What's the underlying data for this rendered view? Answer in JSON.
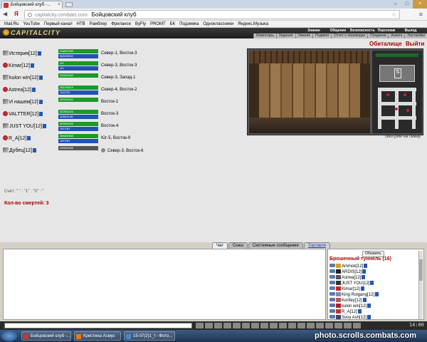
{
  "browser": {
    "tab_title": "Бойцовский клуб -...",
    "url_host": "capitalcity.combats.com",
    "url_title": "Бойцовский клуб",
    "bookmarks": [
      "Mail.Ru",
      "YouTube",
      "Первый канал",
      "НТВ",
      "Рамблер",
      "Фрилансе",
      "ByFly",
      "PROMT",
      "БК",
      "Подземка",
      "Одноклассники",
      "Яндекс.Музыка"
    ]
  },
  "game": {
    "logo": "CAPITALCITY",
    "topmenu": [
      "Знание",
      "Общение",
      "Безопасность",
      "Персонаж",
      "Выход"
    ],
    "submenu": [
      "Инвентарь",
      "Задания",
      "Умения",
      "Подвиги",
      "Отчет о переводах",
      "Поединки",
      "Анкета",
      "Настройки"
    ]
  },
  "players": [
    {
      "name": "Истерия",
      "level": "[12]",
      "hp": "2385/2385",
      "mp": "9652/9652",
      "location": "Север-1, Восток-3"
    },
    {
      "name": "Kimar",
      "level": "[12]",
      "hp": "1/1",
      "mp": "1/1",
      "location": "Север-3, Восток-3"
    },
    {
      "name": "kulon win",
      "level": "[12]",
      "hp": "4340/4340",
      "mp": "",
      "location": "Север-3, Запад-1"
    },
    {
      "name": "Astrea",
      "level": "[12]",
      "hp": "3819/3819",
      "mp": "700/700",
      "location": "Север-4, Восток-2"
    },
    {
      "name": "И нашем",
      "level": "[12]",
      "hp": "4540/4540",
      "mp": "",
      "location": "Восток-1"
    },
    {
      "name": "VALTTER",
      "level": "[12]",
      "hp": "3226/3226",
      "mp": "1138/1138",
      "location": "Восток-3"
    },
    {
      "name": "JUST YOU",
      "level": "[12]",
      "hp": "6399/3409",
      "mp": "787/787",
      "location": "Восток-4"
    },
    {
      "name": "R_A",
      "level": "[12]",
      "hp": "3668/3668",
      "mp": "787/787",
      "location": "Юг-5, Восток-9"
    },
    {
      "name": "Дубец",
      "level": "[12]",
      "hp": "4395/4395",
      "mp": "",
      "location": "Север-3, Восток-6"
    }
  ],
  "score_text": "Счёт: \" \" : \"1\" : \"0\" : \"",
  "deaths_text": "Кол-во смертей: 3",
  "location": {
    "title": "Обиталище",
    "exit_label": "Выйти",
    "caption": "смотрим на север"
  },
  "chat": {
    "tabs": [
      "Чат",
      "Союз",
      "Системные сообщения",
      "Торговля"
    ]
  },
  "online": {
    "refresh_label": "Обновить",
    "title": "Брошенный туннель (16)",
    "users": [
      {
        "name": "Ammok",
        "level": "[12]"
      },
      {
        "name": "ARDIS",
        "level": "[12]"
      },
      {
        "name": "Astrea",
        "level": "[12]"
      },
      {
        "name": "JUST YOU",
        "level": "[12]"
      },
      {
        "name": "Kimar",
        "level": "[12]"
      },
      {
        "name": "King Rolgang",
        "level": "[12]"
      },
      {
        "name": "Korifey",
        "level": "[12]"
      },
      {
        "name": "kulon win",
        "level": "[12]"
      },
      {
        "name": "R_A",
        "level": "[12]"
      },
      {
        "name": "Svoy Ash",
        "level": "[12]"
      }
    ]
  },
  "clock": "14:00",
  "taskbar": {
    "tasks": [
      "Бойцовский клуб -...",
      "Кристина Асмус",
      "15-07(2)1_f - Фото..."
    ],
    "watermark": "photo.scrolls.combats.com"
  }
}
